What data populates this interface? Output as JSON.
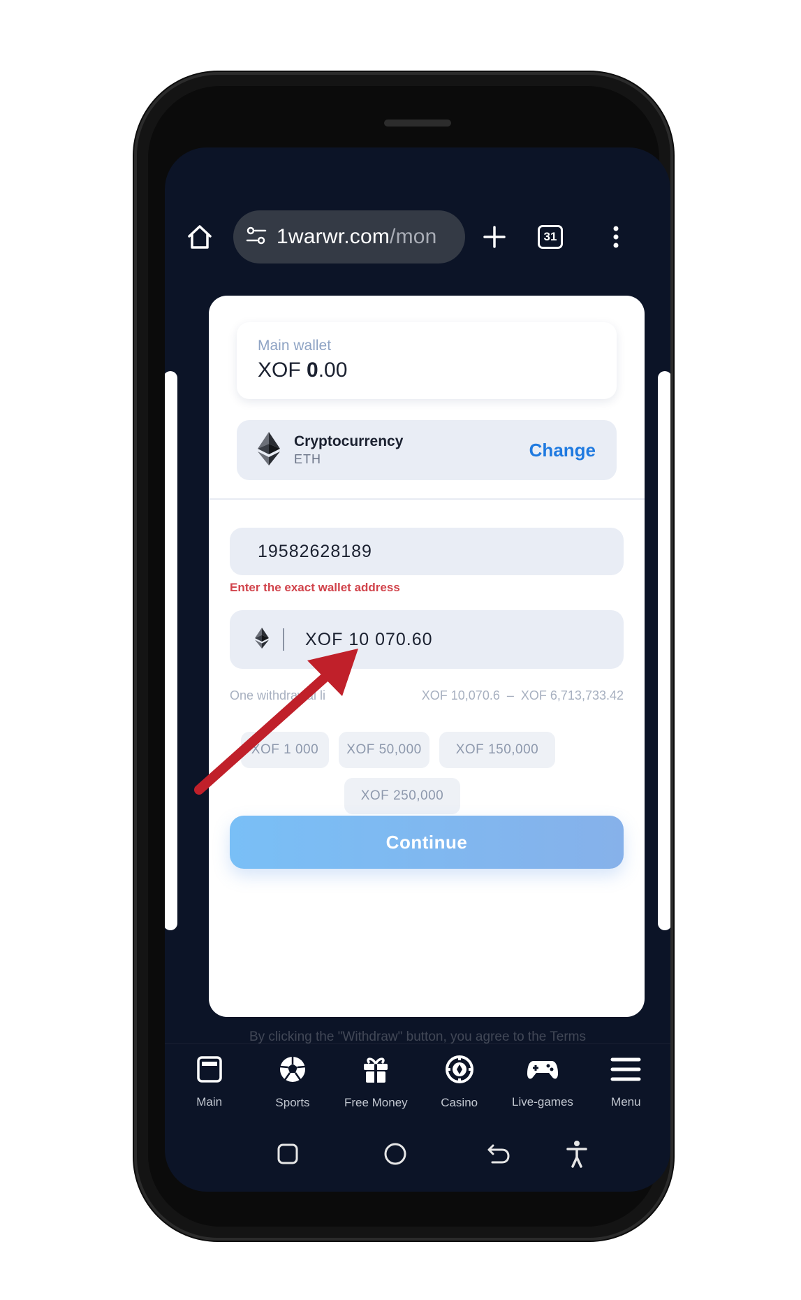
{
  "browser": {
    "url_main": "1warwr.com",
    "url_path": "/mon",
    "tab_count": "31"
  },
  "wallet": {
    "label": "Main wallet",
    "currency": "XOF",
    "amount_int": "0",
    "amount_dec": ".00"
  },
  "method": {
    "title": "Cryptocurrency",
    "subtitle": "ETH",
    "change_label": "Change"
  },
  "address": {
    "value": "19582628189",
    "error": "Enter the exact wallet address"
  },
  "amount": {
    "value": "XOF 10 070.60"
  },
  "limits": {
    "label": "One withdrawal li",
    "min": "XOF 10,070.6",
    "dash": "–",
    "max": "XOF 6,713,733.42"
  },
  "chips": [
    "XOF 1   000",
    "XOF 50,000",
    "XOF 150,000",
    "XOF 250,000"
  ],
  "continue_label": "Continue",
  "terms_text": "By clicking the \"Withdraw\" button, you agree to the Terms",
  "nav": [
    {
      "label": "Main",
      "icon": "window-icon"
    },
    {
      "label": "Sports",
      "icon": "soccer-ball-icon"
    },
    {
      "label": "Free Money",
      "icon": "gift-icon"
    },
    {
      "label": "Casino",
      "icon": "casino-chip-icon"
    },
    {
      "label": "Live-games",
      "icon": "gamepad-icon"
    },
    {
      "label": "Menu",
      "icon": "hamburger-icon"
    }
  ],
  "colors": {
    "screen_bg": "#0c1427",
    "accent": "#1f7ae0",
    "error": "#d1434b",
    "arrow": "#c0202a"
  }
}
